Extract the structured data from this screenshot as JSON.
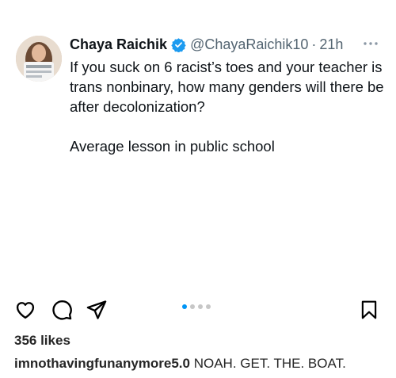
{
  "tweet": {
    "author_name": "Chaya Raichik",
    "verified": true,
    "handle": "@ChayaRaichik10",
    "separator": "·",
    "time": "21h",
    "more_icon": "more-horizontal-icon",
    "text": "If you suck on 6 racist’s toes and your teacher is trans nonbinary, how many genders will there be after decolonization?\n\nAverage lesson in public school",
    "colors": {
      "text": "#0f1419",
      "muted": "#536471",
      "verified": "#1d9bf0"
    }
  },
  "actions": {
    "icons": [
      "heart-icon",
      "comment-icon",
      "share-icon",
      "bookmark-icon"
    ]
  },
  "carousel": {
    "total": 4,
    "active_index": 0,
    "active_color": "#0095f6"
  },
  "likes": {
    "text": "356 likes"
  },
  "caption": {
    "username": "imnothavingfunanymore5.0",
    "text": "NOAH. GET. THE. BOAT."
  }
}
